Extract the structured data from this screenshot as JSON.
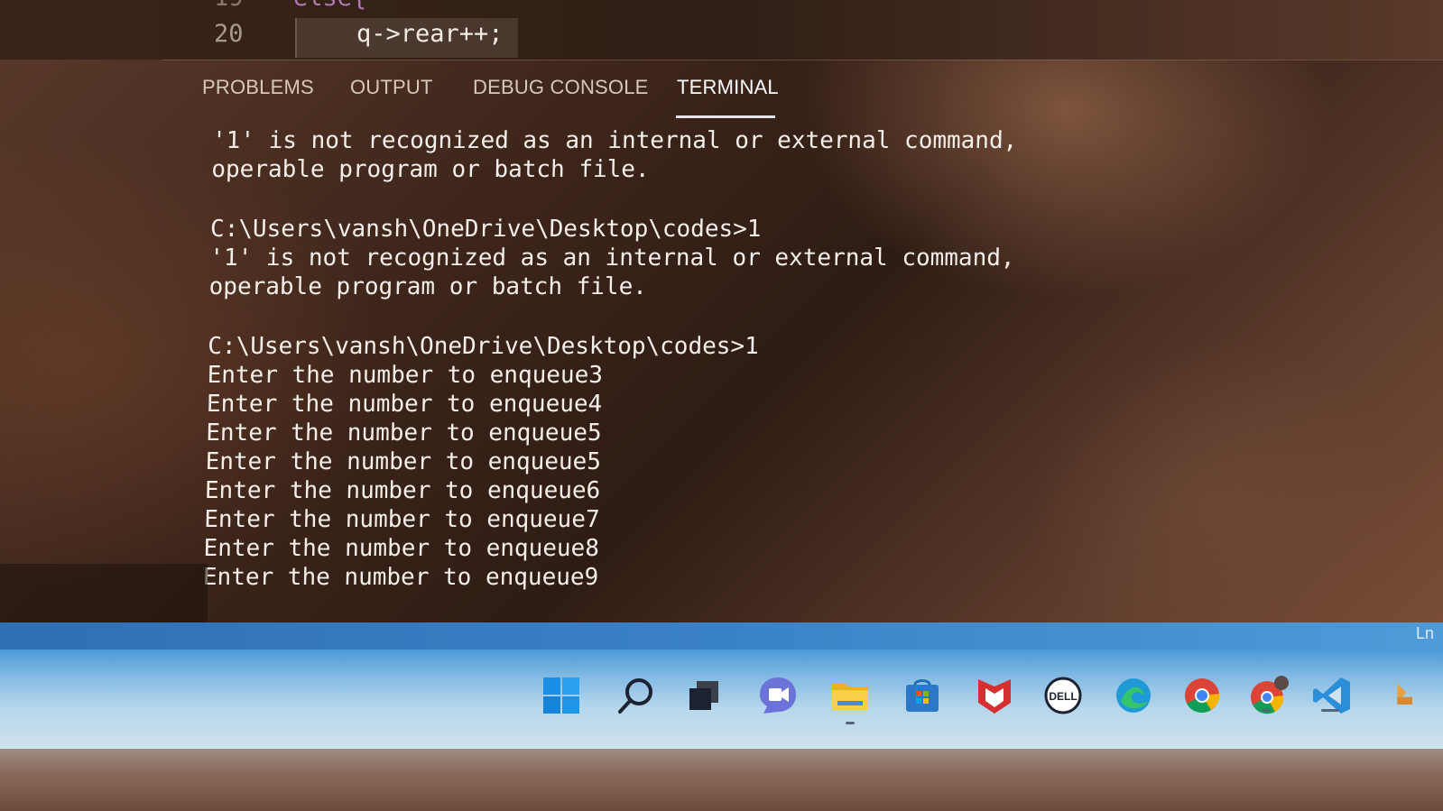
{
  "editor": {
    "faded_line_number": "19",
    "faded_code": "else{",
    "line_number": "20",
    "code": "q->rear++;"
  },
  "panel": {
    "tabs": [
      {
        "label": "PROBLEMS",
        "active": false
      },
      {
        "label": "OUTPUT",
        "active": false
      },
      {
        "label": "DEBUG CONSOLE",
        "active": false
      },
      {
        "label": "TERMINAL",
        "active": true
      }
    ]
  },
  "terminal": {
    "lines": [
      "'1' is not recognized as an internal or external command,",
      "operable program or batch file.",
      "",
      "C:\\Users\\vansh\\OneDrive\\Desktop\\codes>1",
      "'1' is not recognized as an internal or external command,",
      "operable program or batch file.",
      "",
      "C:\\Users\\vansh\\OneDrive\\Desktop\\codes>1",
      "Enter the number to enqueue3",
      "Enter the number to enqueue4",
      "Enter the number to enqueue5",
      "Enter the number to enqueue5",
      "Enter the number to enqueue6",
      "Enter the number to enqueue7",
      "Enter the number to enqueue8",
      "Enter the number to enqueue9"
    ]
  },
  "status_bar": {
    "position_label": "Ln"
  },
  "taskbar": {
    "icons": [
      "windows-start-icon",
      "search-icon",
      "task-view-icon",
      "teams-chat-icon",
      "file-explorer-icon",
      "microsoft-store-icon",
      "mcafee-icon",
      "dell-icon",
      "edge-icon",
      "chrome-icon",
      "chrome-profile-icon",
      "vscode-icon",
      "overflow-icon"
    ]
  }
}
